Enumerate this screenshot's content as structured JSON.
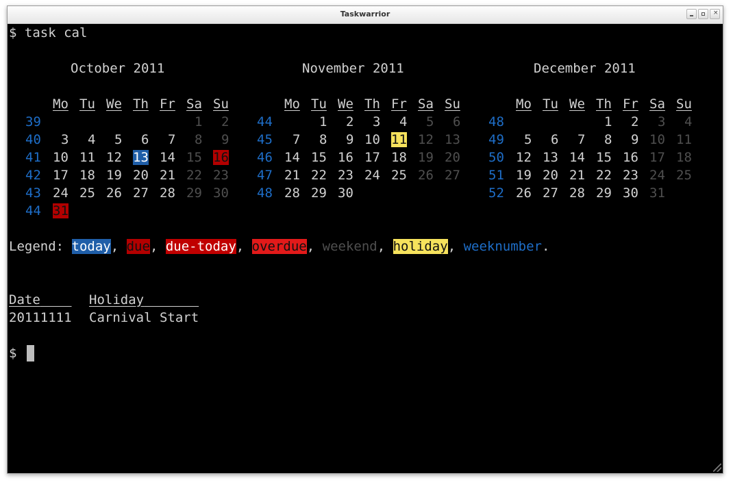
{
  "window": {
    "title": "Taskwarrior"
  },
  "terminal": {
    "command_line": "$ task cal",
    "months": [
      {
        "title": "October 2011",
        "header": [
          "Mo",
          "Tu",
          "We",
          "Th",
          "Fr",
          "Sa",
          "Su"
        ],
        "rows": [
          {
            "week": "39",
            "days": [
              "",
              "",
              "",
              "",
              "",
              "1",
              "2"
            ]
          },
          {
            "week": "40",
            "days": [
              "3",
              "4",
              "5",
              "6",
              "7",
              "8",
              "9"
            ]
          },
          {
            "week": "41",
            "days": [
              "10",
              "11",
              "12",
              "13",
              "14",
              "15",
              "16"
            ]
          },
          {
            "week": "42",
            "days": [
              "17",
              "18",
              "19",
              "20",
              "21",
              "22",
              "23"
            ]
          },
          {
            "week": "43",
            "days": [
              "24",
              "25",
              "26",
              "27",
              "28",
              "29",
              "30"
            ]
          },
          {
            "week": "44",
            "days": [
              "31",
              "",
              "",
              "",
              "",
              "",
              ""
            ]
          }
        ],
        "highlights": {
          "2-3": "today",
          "2-6": "due",
          "5-0": "due"
        }
      },
      {
        "title": "November 2011",
        "header": [
          "Mo",
          "Tu",
          "We",
          "Th",
          "Fr",
          "Sa",
          "Su"
        ],
        "rows": [
          {
            "week": "44",
            "days": [
              "",
              "1",
              "2",
              "3",
              "4",
              "5",
              "6"
            ]
          },
          {
            "week": "45",
            "days": [
              "7",
              "8",
              "9",
              "10",
              "11",
              "12",
              "13"
            ]
          },
          {
            "week": "46",
            "days": [
              "14",
              "15",
              "16",
              "17",
              "18",
              "19",
              "20"
            ]
          },
          {
            "week": "47",
            "days": [
              "21",
              "22",
              "23",
              "24",
              "25",
              "26",
              "27"
            ]
          },
          {
            "week": "48",
            "days": [
              "28",
              "29",
              "30",
              "",
              "",
              "",
              ""
            ]
          }
        ],
        "highlights": {
          "1-4": "holiday"
        }
      },
      {
        "title": "December 2011",
        "header": [
          "Mo",
          "Tu",
          "We",
          "Th",
          "Fr",
          "Sa",
          "Su"
        ],
        "rows": [
          {
            "week": "48",
            "days": [
              "",
              "",
              "",
              "1",
              "2",
              "3",
              "4"
            ]
          },
          {
            "week": "49",
            "days": [
              "5",
              "6",
              "7",
              "8",
              "9",
              "10",
              "11"
            ]
          },
          {
            "week": "50",
            "days": [
              "12",
              "13",
              "14",
              "15",
              "16",
              "17",
              "18"
            ]
          },
          {
            "week": "51",
            "days": [
              "19",
              "20",
              "21",
              "22",
              "23",
              "24",
              "25"
            ]
          },
          {
            "week": "52",
            "days": [
              "26",
              "27",
              "28",
              "29",
              "30",
              "31",
              ""
            ]
          }
        ],
        "highlights": {}
      }
    ],
    "legend": {
      "label": "Legend:",
      "items": [
        "today",
        "due",
        "due-today",
        "overdue",
        "weekend",
        "holiday",
        "weeknumber"
      ],
      "separator": ",",
      "end": "."
    },
    "holidays_table": {
      "headers": [
        "Date",
        "Holiday"
      ],
      "rows": [
        [
          "20111111",
          "Carnival Start"
        ]
      ]
    },
    "prompt": "$"
  },
  "colors": {
    "today": "#1f5ea8",
    "due": "#b30000",
    "due_today": "#c00000",
    "overdue": "#e21a1a",
    "holiday": "#f6e25c",
    "weeknumber": "#1e6ec8",
    "weekend": "#4f4f4f"
  }
}
